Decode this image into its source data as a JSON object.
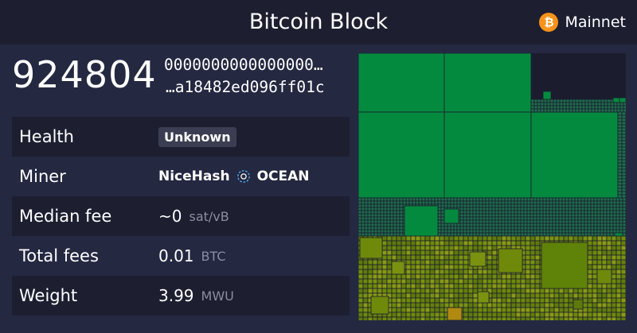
{
  "header": {
    "title": "Bitcoin Block",
    "network": "Mainnet",
    "network_icon": "bitcoin-icon"
  },
  "block": {
    "height": "924804",
    "hash_line1": "0000000000000000…",
    "hash_line2": "…a18482ed096ff01c"
  },
  "stats": {
    "health": {
      "label": "Health",
      "value": "Unknown"
    },
    "miner": {
      "label": "Miner",
      "pool": "NiceHash",
      "template": "OCEAN",
      "icon": "ocean-icon"
    },
    "median_fee": {
      "label": "Median fee",
      "value": "~0",
      "unit": "sat/vB"
    },
    "total_fees": {
      "label": "Total fees",
      "value": "0.01",
      "unit": "BTC"
    },
    "weight": {
      "label": "Weight",
      "value": "3.99",
      "unit": "MWU"
    }
  },
  "colors": {
    "header_bg": "#1d1f31",
    "page_bg": "#242841",
    "accent": "#f7931a",
    "high_fee_green": "#048a3f",
    "mid_fee_teal": "#1e6e4c",
    "low_fee_olive": "#6f8a0a"
  }
}
